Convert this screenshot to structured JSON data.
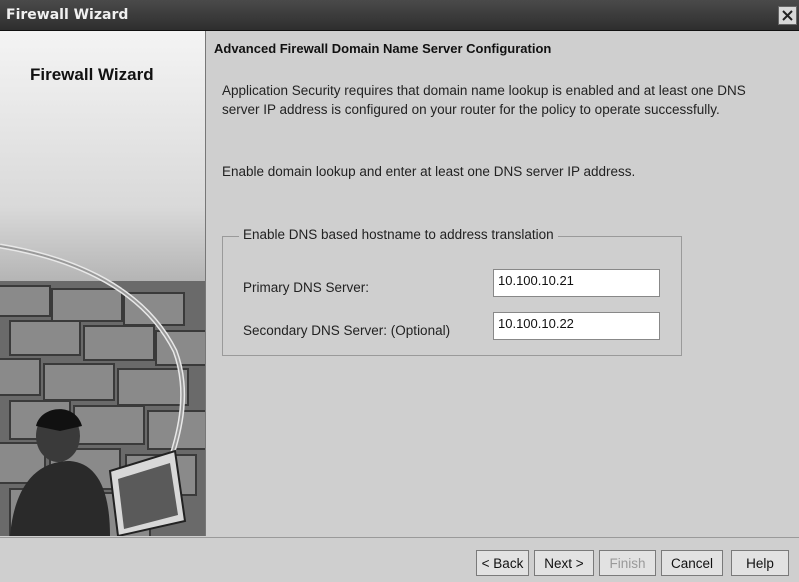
{
  "window": {
    "title": "Firewall Wizard"
  },
  "sidebar": {
    "title": "Firewall Wizard"
  },
  "main": {
    "heading": "Advanced Firewall Domain Name Server Configuration",
    "paragraph1": "Application Security requires that domain name lookup is enabled and at least one DNS server IP address is configured on your router for the policy to operate successfully.",
    "paragraph2": "Enable domain lookup and enter at least one DNS server IP address.",
    "group": {
      "legend": "Enable DNS based hostname to address translation",
      "primary_label": "Primary DNS Server:",
      "primary_value": "10.100.10.21",
      "secondary_label": "Secondary DNS Server: (Optional)",
      "secondary_value": "10.100.10.22"
    }
  },
  "footer": {
    "back": "< Back",
    "next": "Next >",
    "finish": "Finish",
    "cancel": "Cancel",
    "help": "Help"
  },
  "icons": {
    "close": "close-icon"
  }
}
